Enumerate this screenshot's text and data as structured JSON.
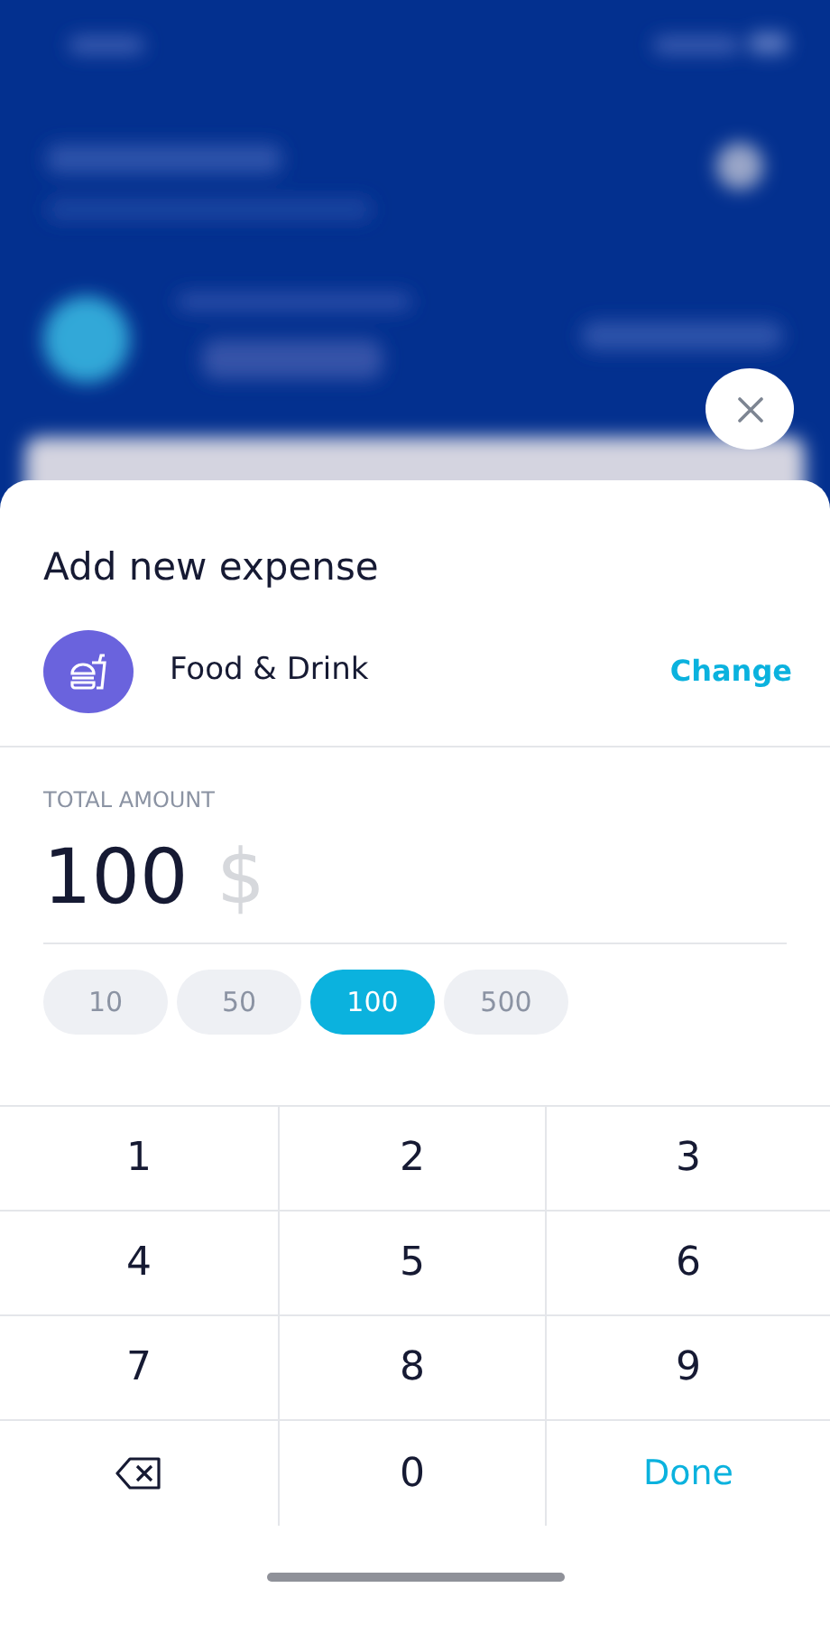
{
  "sheet": {
    "title": "Add new expense"
  },
  "category": {
    "name": "Food & Drink",
    "action": "Change"
  },
  "amount": {
    "label": "TOTAL AMOUNT",
    "value": "100",
    "currency": "$"
  },
  "presets": [
    {
      "label": "10",
      "selected": false
    },
    {
      "label": "50",
      "selected": false
    },
    {
      "label": "100",
      "selected": true
    },
    {
      "label": "500",
      "selected": false
    }
  ],
  "keypad": [
    {
      "kind": "digit",
      "label": "1"
    },
    {
      "kind": "digit",
      "label": "2"
    },
    {
      "kind": "digit",
      "label": "3"
    },
    {
      "kind": "digit",
      "label": "4"
    },
    {
      "kind": "digit",
      "label": "5"
    },
    {
      "kind": "digit",
      "label": "6"
    },
    {
      "kind": "digit",
      "label": "7"
    },
    {
      "kind": "digit",
      "label": "8"
    },
    {
      "kind": "digit",
      "label": "9"
    },
    {
      "kind": "backspace"
    },
    {
      "kind": "digit",
      "label": "0"
    },
    {
      "kind": "done",
      "label": "Done"
    }
  ]
}
